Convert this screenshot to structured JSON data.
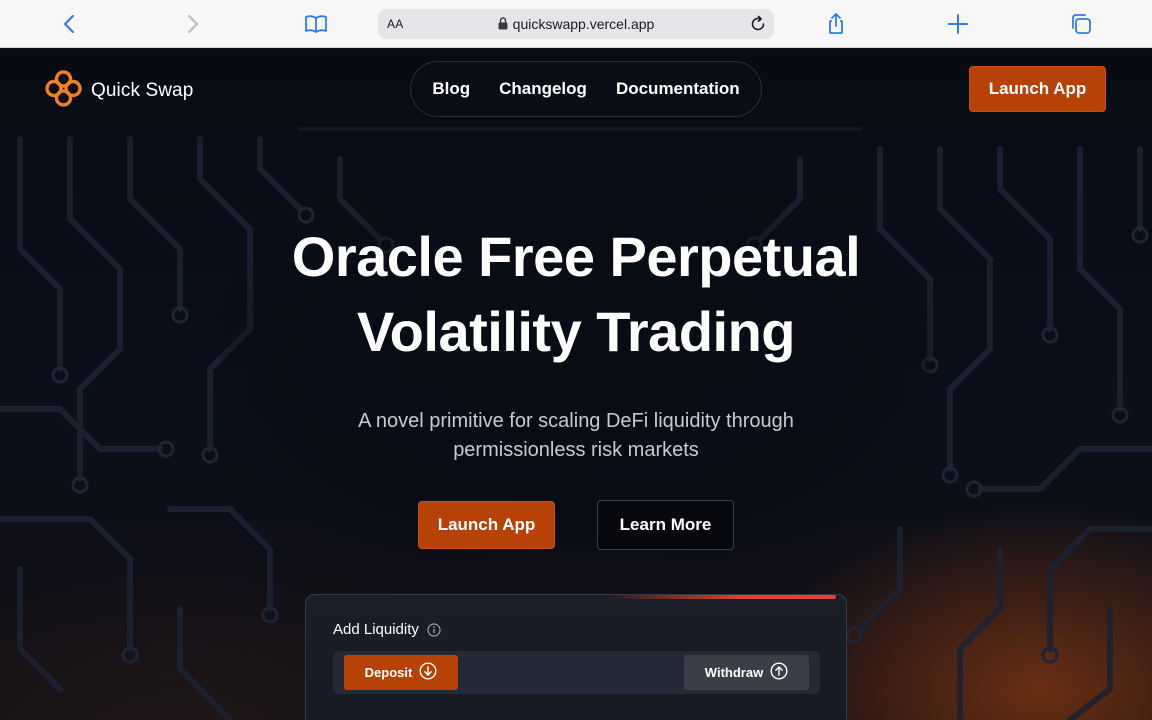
{
  "browser": {
    "text_size_label": "AA",
    "url": "quickswapp.vercel.app"
  },
  "nav": {
    "brand": "Quick Swap",
    "links": [
      "Blog",
      "Changelog",
      "Documentation"
    ],
    "launch_label": "Launch App"
  },
  "hero": {
    "title_line1": "Oracle Free Perpetual",
    "title_line2": "Volatility Trading",
    "subtitle_line1": "A novel primitive for scaling DeFi liquidity through",
    "subtitle_line2": "permissionless risk markets",
    "launch_label": "Launch App",
    "learn_label": "Learn More"
  },
  "card": {
    "title": "Add Liquidity",
    "tab_deposit": "Deposit",
    "tab_withdraw": "Withdraw"
  },
  "colors": {
    "accent": "#b64208",
    "background": "#0b0e17",
    "browser_tint": "#2f7cf6"
  },
  "icons": [
    "back-icon",
    "forward-icon",
    "bookmarks-icon",
    "lock-icon",
    "reload-icon",
    "share-icon",
    "new-tab-icon",
    "tabs-icon",
    "logo-icon",
    "info-icon",
    "arrow-down-circle-icon",
    "arrow-up-circle-icon"
  ]
}
